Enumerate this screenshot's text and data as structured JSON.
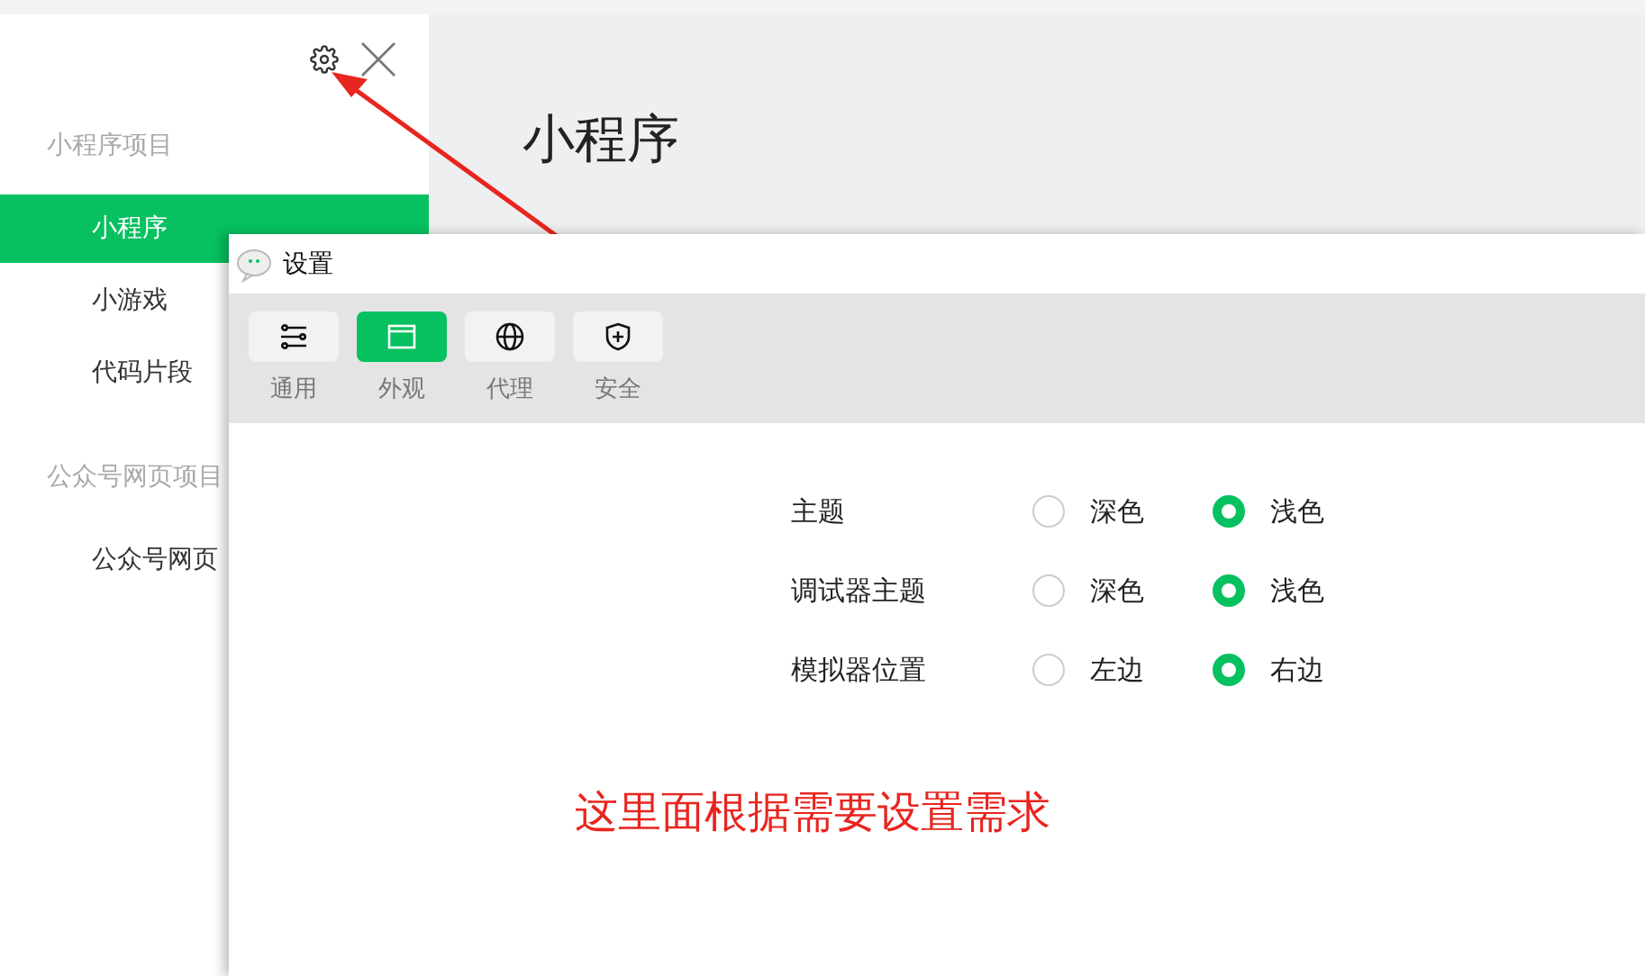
{
  "sidebar": {
    "sections": [
      {
        "title": "小程序项目",
        "items": [
          {
            "label": "小程序",
            "selected": true
          },
          {
            "label": "小游戏",
            "selected": false
          },
          {
            "label": "代码片段",
            "selected": false
          }
        ]
      },
      {
        "title": "公众号网页项目",
        "items": [
          {
            "label": "公众号网页",
            "selected": false
          }
        ]
      }
    ]
  },
  "main": {
    "title": "小程序"
  },
  "dialog": {
    "title": "设置",
    "tabs": [
      {
        "label": "通用",
        "selected": false
      },
      {
        "label": "外观",
        "selected": true
      },
      {
        "label": "代理",
        "selected": false
      },
      {
        "label": "安全",
        "selected": false
      }
    ],
    "settings": [
      {
        "label": "主题",
        "options": [
          {
            "label": "深色",
            "selected": false
          },
          {
            "label": "浅色",
            "selected": true
          }
        ]
      },
      {
        "label": "调试器主题",
        "options": [
          {
            "label": "深色",
            "selected": false
          },
          {
            "label": "浅色",
            "selected": true
          }
        ]
      },
      {
        "label": "模拟器位置",
        "options": [
          {
            "label": "左边",
            "selected": false
          },
          {
            "label": "右边",
            "selected": true
          }
        ]
      }
    ]
  },
  "annotation": {
    "text": "这里面根据需要设置需求"
  }
}
